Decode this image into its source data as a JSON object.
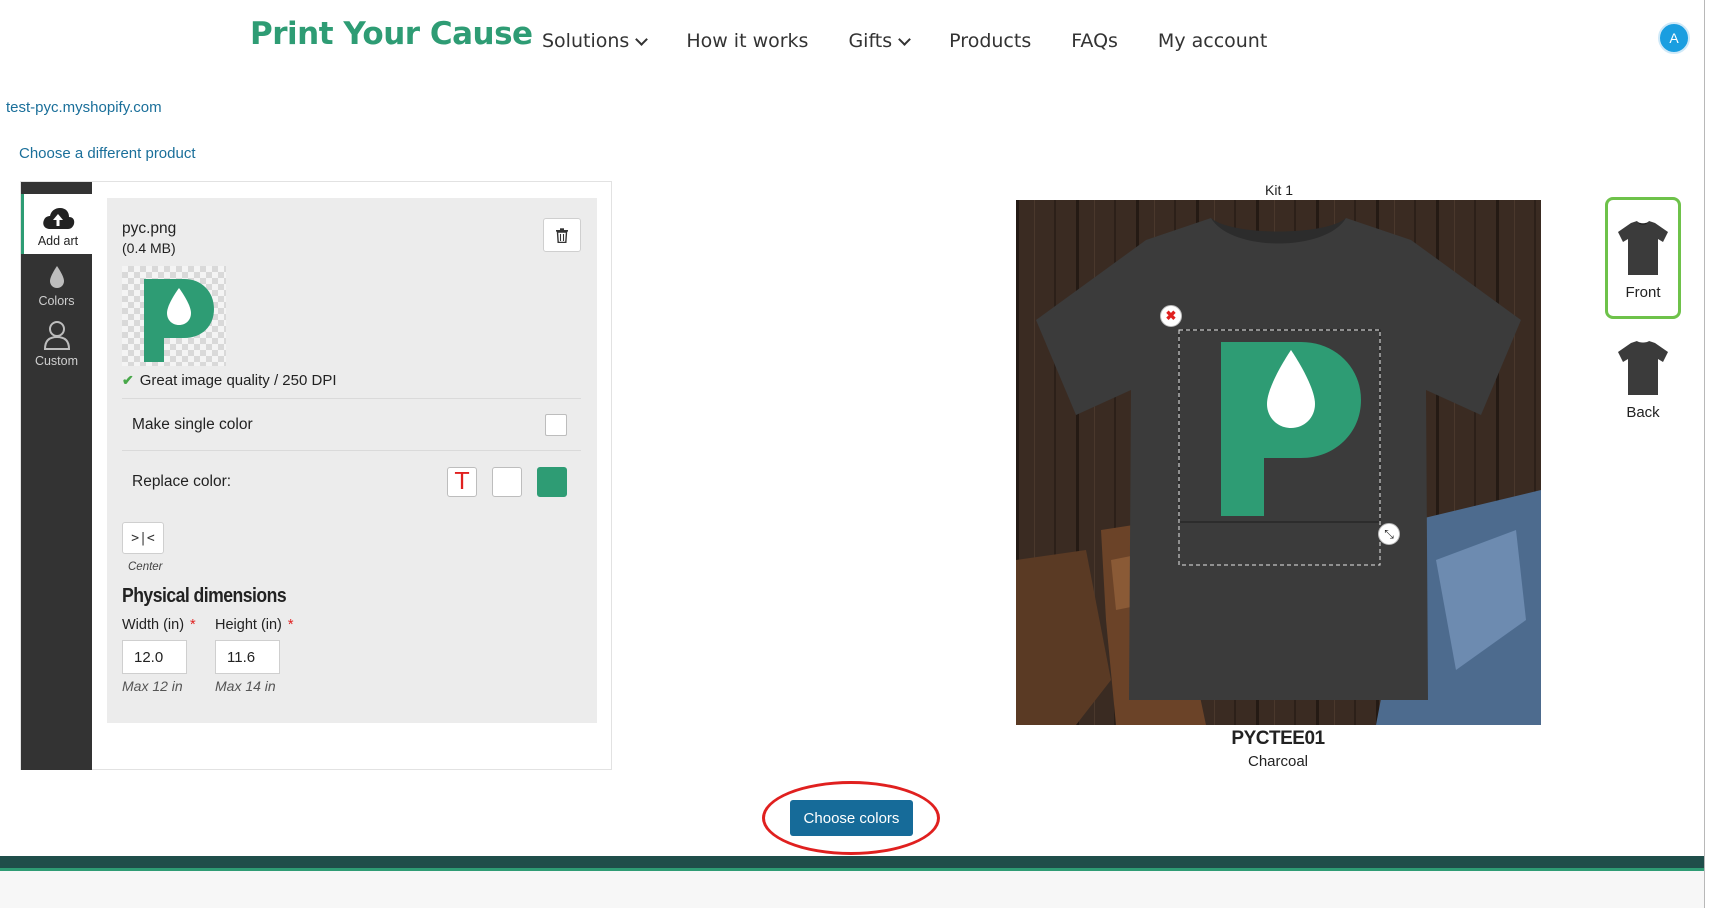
{
  "header": {
    "brand": "Print Your Cause",
    "nav": [
      {
        "label": "Solutions"
      },
      {
        "label": "How it works"
      },
      {
        "label": "Gifts"
      },
      {
        "label": "Products"
      },
      {
        "label": "FAQs"
      },
      {
        "label": "My account"
      }
    ],
    "avatar_initial": "A"
  },
  "shop_link": "test-pyc.myshopify.com",
  "change_product_link": "Choose a different product",
  "sidebar": {
    "tabs": [
      {
        "label": "Add art",
        "icon": "cloud-upload-icon",
        "active": true
      },
      {
        "label": "Colors",
        "icon": "droplet-icon"
      },
      {
        "label": "Custom",
        "icon": "person-icon"
      }
    ]
  },
  "art": {
    "file_name": "pyc.png",
    "file_size": "(0.4 MB)",
    "quality_text": "Great image quality / 250 DPI",
    "single_color_label": "Make single color",
    "replace_color_label": "Replace color:",
    "swatch_text_glyph": "T",
    "colors": {
      "brand": "#2e9c74",
      "white": "#ffffff",
      "accent_red": "#e0201f"
    },
    "center_label": "Center",
    "center_glyph": ">|<"
  },
  "dimensions": {
    "title": "Physical dimensions",
    "width_label": "Width (in)",
    "height_label": "Height (in)",
    "required_mark": "*",
    "width_value": "12.0",
    "height_value": "11.6",
    "width_hint": "Max 12 in",
    "height_hint": "Max 14 in"
  },
  "preview": {
    "kit_label": "Kit 1",
    "product_code": "PYCTEE01",
    "product_color": "Charcoal",
    "shirt_color": "#3b3b3b"
  },
  "views": [
    {
      "label": "Front",
      "selected": true
    },
    {
      "label": "Back",
      "selected": false
    }
  ],
  "cta": {
    "label": "Choose colors"
  }
}
